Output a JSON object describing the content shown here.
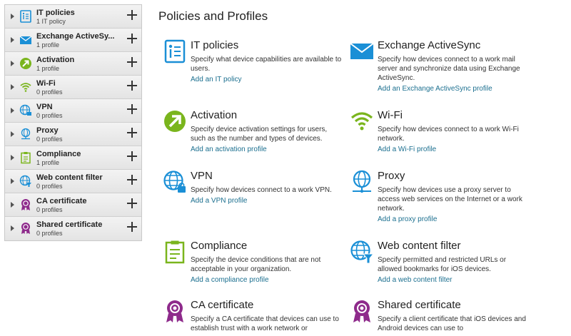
{
  "sidebar": {
    "items": [
      {
        "title": "IT policies",
        "subtitle": "1 IT policy",
        "icon": "it-policy-icon"
      },
      {
        "title": "Exchange ActiveSy...",
        "subtitle": "1 profile",
        "icon": "mail-icon"
      },
      {
        "title": "Activation",
        "subtitle": "1 profile",
        "icon": "activation-icon"
      },
      {
        "title": "Wi-Fi",
        "subtitle": "0 profiles",
        "icon": "wifi-icon"
      },
      {
        "title": "VPN",
        "subtitle": "0 profiles",
        "icon": "vpn-globe-icon"
      },
      {
        "title": "Proxy",
        "subtitle": "0 profiles",
        "icon": "proxy-icon"
      },
      {
        "title": "Compliance",
        "subtitle": "1 profile",
        "icon": "compliance-clipboard-icon"
      },
      {
        "title": "Web content filter",
        "subtitle": "0 profiles",
        "icon": "web-filter-icon"
      },
      {
        "title": "CA certificate",
        "subtitle": "0 profiles",
        "icon": "certificate-icon"
      },
      {
        "title": "Shared certificate",
        "subtitle": "0 profiles",
        "icon": "shared-certificate-icon"
      }
    ]
  },
  "main": {
    "title": "Policies and Profiles",
    "cards": [
      {
        "title": "IT policies",
        "desc": "Specify what device capabilities are available to users.",
        "link": "Add an IT policy"
      },
      {
        "title": "Exchange ActiveSync",
        "desc": "Specify how devices connect to a work mail server and synchronize data using Exchange ActiveSync.",
        "link": "Add an Exchange ActiveSync profile"
      },
      {
        "title": "Activation",
        "desc": "Specify device activation settings for users, such as the number and types of devices.",
        "link": "Add an activation profile"
      },
      {
        "title": "Wi-Fi",
        "desc": "Specify how devices connect to a work Wi-Fi network.",
        "link": "Add a Wi-Fi profile"
      },
      {
        "title": "VPN",
        "desc": "Specify how devices connect to a work VPN.",
        "link": "Add a VPN profile"
      },
      {
        "title": "Proxy",
        "desc": "Specify how devices use a proxy server to access web services on the Internet or a work network.",
        "link": "Add a proxy profile"
      },
      {
        "title": "Compliance",
        "desc": "Specify the device conditions that are not acceptable in your organization.",
        "link": "Add a compliance profile"
      },
      {
        "title": "Web content filter",
        "desc": "Specify permitted and restricted URLs or allowed bookmarks for iOS devices.",
        "link": "Add a web content filter"
      },
      {
        "title": "CA certificate",
        "desc": "Specify a CA certificate that devices can use to establish trust with a work network or",
        "link": ""
      },
      {
        "title": "Shared certificate",
        "desc": "Specify a client certificate that iOS devices and Android devices can use to",
        "link": ""
      }
    ]
  },
  "colors": {
    "blue": "#1a8fd6",
    "green": "#7ab51d",
    "purple": "#8e2a8b",
    "link": "#1b6f8f"
  }
}
